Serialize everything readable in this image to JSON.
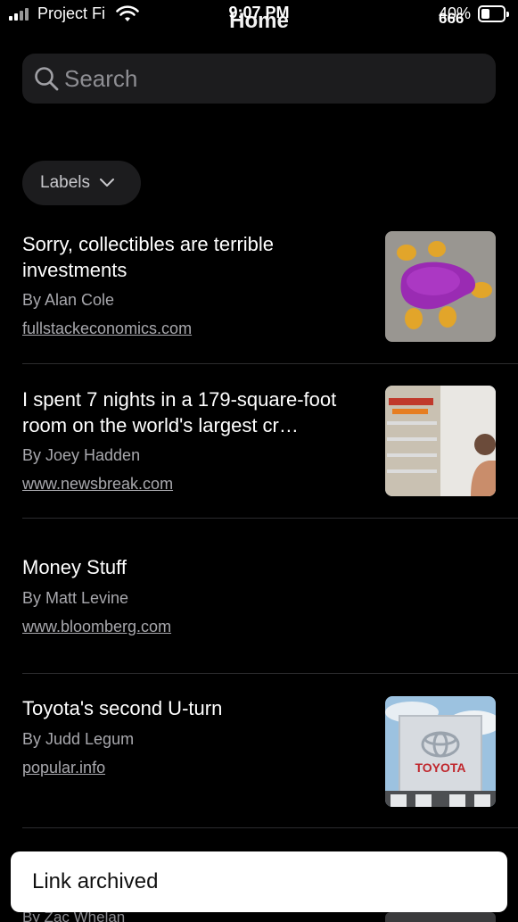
{
  "status_bar": {
    "carrier": "Project Fi",
    "time": "9:07 PM",
    "battery": "40%",
    "battery_level": 0.4,
    "overlap_title": "Home",
    "overlap_text": "666"
  },
  "search": {
    "placeholder": "Search"
  },
  "labels_filter": {
    "label": "Labels"
  },
  "articles": [
    {
      "title": "Sorry, collectibles are terrible investments",
      "author": "By Alan Cole",
      "site": "fullstackeconomics.com",
      "thumbnail": "purple-toy-photo"
    },
    {
      "title": "I spent 7 nights in a 179-square-foot room on the world's largest cr…",
      "author": "By Joey Hadden",
      "site": "www.newsbreak.com",
      "thumbnail": "cruise-ship-photo"
    },
    {
      "title": "Money Stuff",
      "author": "By Matt Levine",
      "site": "www.bloomberg.com",
      "thumbnail": ""
    },
    {
      "title": "Toyota's second U-turn",
      "author": "By Judd Legum",
      "site": "popular.info",
      "thumbnail": "toyota-dealership-photo",
      "thumbnail_text": "TOYOTA"
    }
  ],
  "peek_article": {
    "author": "By Zac Whelan"
  },
  "toast": {
    "message": "Link archived"
  },
  "colors": {
    "background": "#000000",
    "surface": "#1c1c1e",
    "secondary_text": "#a8a8ad",
    "toast_bg": "#ffffff"
  }
}
